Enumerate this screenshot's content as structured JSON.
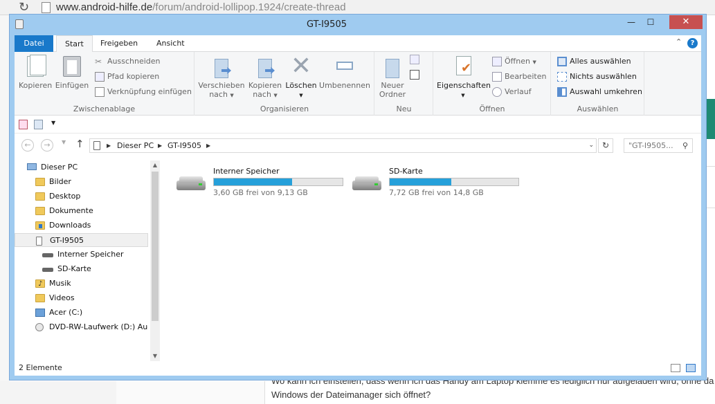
{
  "browser": {
    "url_host": "www.android-hilfe.de",
    "url_path": "/forum/android-lollipop.1924/create-thread",
    "bg_text_1": "Wo kann ich einstellen, dass wenn ich das Handy am Laptop klemme es lediglich nur aufgeladen wird, ohne da",
    "bg_text_2": "Windows der Dateimanager sich öffnet?"
  },
  "window": {
    "title": "GT-I9505",
    "minimize": "—",
    "maximize": "☐",
    "close": "✕"
  },
  "ribbon": {
    "tabs": [
      "Datei",
      "Start",
      "Freigeben",
      "Ansicht"
    ],
    "groups": {
      "clipboard": {
        "label": "Zwischenablage",
        "copy": "Kopieren",
        "paste": "Einfügen",
        "cut": "Ausschneiden",
        "copy_path": "Pfad kopieren",
        "paste_shortcut": "Verknüpfung einfügen"
      },
      "organize": {
        "label": "Organisieren",
        "move_to_1": "Verschieben",
        "move_to_2": "nach",
        "copy_to_1": "Kopieren",
        "copy_to_2": "nach",
        "delete": "Löschen",
        "rename": "Umbenennen"
      },
      "new": {
        "label": "Neu",
        "new_folder_1": "Neuer",
        "new_folder_2": "Ordner"
      },
      "open": {
        "label": "Öffnen",
        "properties": "Eigenschaften",
        "open": "Öffnen",
        "edit": "Bearbeiten",
        "history": "Verlauf"
      },
      "select": {
        "label": "Auswählen",
        "select_all": "Alles auswählen",
        "select_none": "Nichts auswählen",
        "invert": "Auswahl umkehren"
      }
    }
  },
  "address": {
    "crumbs": [
      "Dieser PC",
      "GT-I9505"
    ],
    "search_placeholder": "\"GT-I9505..."
  },
  "navpane": {
    "items": [
      {
        "label": "Dieser PC",
        "icon": "computer-icon"
      },
      {
        "label": "Bilder",
        "icon": "folder-icon"
      },
      {
        "label": "Desktop",
        "icon": "folder-icon"
      },
      {
        "label": "Dokumente",
        "icon": "folder-icon"
      },
      {
        "label": "Downloads",
        "icon": "downloads-folder-icon"
      },
      {
        "label": "GT-I9505",
        "icon": "phone-icon"
      },
      {
        "label": "Interner Speicher",
        "icon": "drive-icon"
      },
      {
        "label": "SD-Karte",
        "icon": "drive-icon"
      },
      {
        "label": "Musik",
        "icon": "music-folder-icon"
      },
      {
        "label": "Videos",
        "icon": "folder-icon"
      },
      {
        "label": "Acer (C:)",
        "icon": "disk-icon"
      },
      {
        "label": "DVD-RW-Laufwerk (D:) Aud",
        "icon": "dvd-icon"
      }
    ]
  },
  "drives": [
    {
      "name": "Interner Speicher",
      "free": "3,60 GB frei von 9,13 GB",
      "used_fraction": 0.606
    },
    {
      "name": "SD-Karte",
      "free": "7,72 GB frei von 14,8 GB",
      "used_fraction": 0.478
    }
  ],
  "status": {
    "count": "2 Elemente"
  },
  "colors": {
    "accent": "#1979ca",
    "bar_fill": "#26a0da",
    "close_red": "#c75050"
  }
}
